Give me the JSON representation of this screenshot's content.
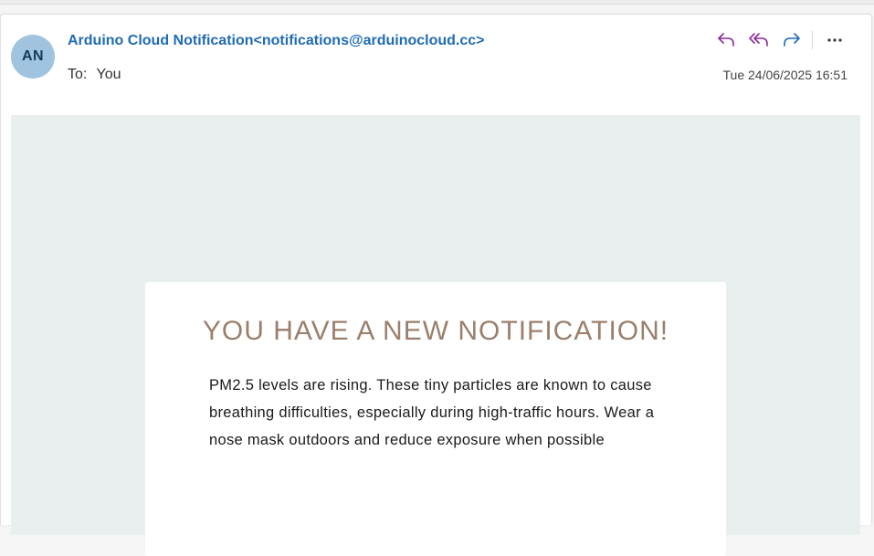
{
  "email": {
    "avatar_initials": "AN",
    "sender": "Arduino Cloud Notification<notifications@arduinocloud.cc>",
    "to_label": "To:",
    "to_value": "You",
    "date": "Tue 24/06/2025 16:51"
  },
  "actions": [
    {
      "name": "reply-button",
      "icon": "reply-icon",
      "color": "#8a2a9c"
    },
    {
      "name": "reply-all-button",
      "icon": "reply-all-icon",
      "color": "#8a2a9c"
    },
    {
      "name": "forward-button",
      "icon": "forward-icon",
      "color": "#1f6bb4"
    },
    {
      "name": "more-actions-button",
      "icon": "more-icon",
      "color": "#333333"
    }
  ],
  "message": {
    "title": "YOU HAVE A NEW NOTIFICATION!",
    "text": "PM2.5 levels are rising. These tiny particles are known to cause breathing difficulties, especially during high-traffic hours. Wear a nose mask outdoors and reduce exposure when possible"
  },
  "colors": {
    "accent": "#1f6bb4",
    "title": "#9a806c",
    "body_background": "#e9efee"
  }
}
